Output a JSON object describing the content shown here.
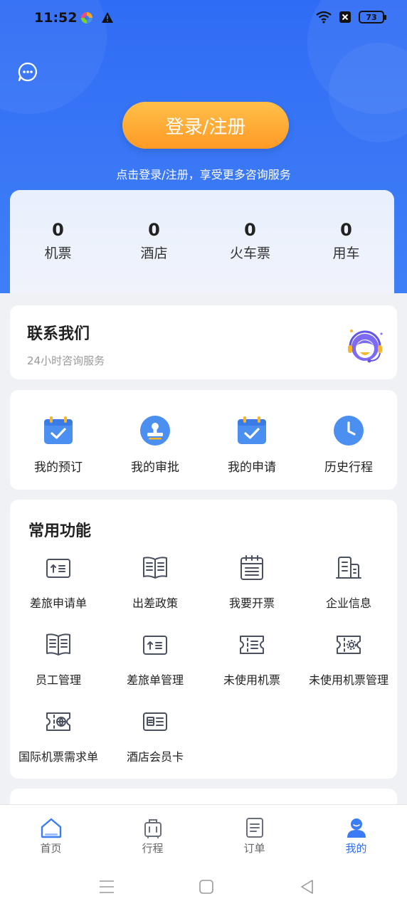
{
  "status_bar": {
    "time": "11:52",
    "battery": "73",
    "icons": [
      "colorful-app-icon",
      "warning-icon",
      "wifi-icon",
      "no-sim-icon",
      "battery-icon"
    ]
  },
  "header": {
    "login_button": "登录/注册",
    "hint": "点击登录/注册，享受更多咨询服务",
    "chat_icon": "chat-bubble-icon"
  },
  "stats": [
    {
      "value": "0",
      "label": "机票"
    },
    {
      "value": "0",
      "label": "酒店"
    },
    {
      "value": "0",
      "label": "火车票"
    },
    {
      "value": "0",
      "label": "用车"
    }
  ],
  "contact": {
    "title": "联系我们",
    "subtitle": "24小时咨询服务",
    "icon": "customer-service-icon"
  },
  "quick_actions": [
    {
      "label": "我的预订",
      "icon": "calendar-check-icon"
    },
    {
      "label": "我的审批",
      "icon": "stamp-icon"
    },
    {
      "label": "我的申请",
      "icon": "calendar-check-icon"
    },
    {
      "label": "历史行程",
      "icon": "clock-icon"
    }
  ],
  "features": {
    "title": "常用功能",
    "items": [
      {
        "label": "差旅申请单",
        "icon": "application-form-icon"
      },
      {
        "label": "出差政策",
        "icon": "open-book-icon"
      },
      {
        "label": "我要开票",
        "icon": "invoice-icon"
      },
      {
        "label": "企业信息",
        "icon": "building-icon"
      },
      {
        "label": "员工管理",
        "icon": "open-book-icon"
      },
      {
        "label": "差旅单管理",
        "icon": "application-form-icon"
      },
      {
        "label": "未使用机票",
        "icon": "ticket-icon"
      },
      {
        "label": "未使用机票管理",
        "icon": "ticket-settings-icon"
      },
      {
        "label": "国际机票需求单",
        "icon": "ticket-globe-icon"
      },
      {
        "label": "酒店会员卡",
        "icon": "member-card-icon"
      }
    ]
  },
  "tabbar": [
    {
      "label": "首页",
      "icon": "home-icon",
      "active": false
    },
    {
      "label": "行程",
      "icon": "luggage-icon",
      "active": false
    },
    {
      "label": "订单",
      "icon": "order-list-icon",
      "active": false
    },
    {
      "label": "我的",
      "icon": "profile-icon",
      "active": true
    }
  ],
  "colors": {
    "primary": "#2f6cf5",
    "login_orange": "#ffa630",
    "page_bg": "#eff1f5"
  }
}
